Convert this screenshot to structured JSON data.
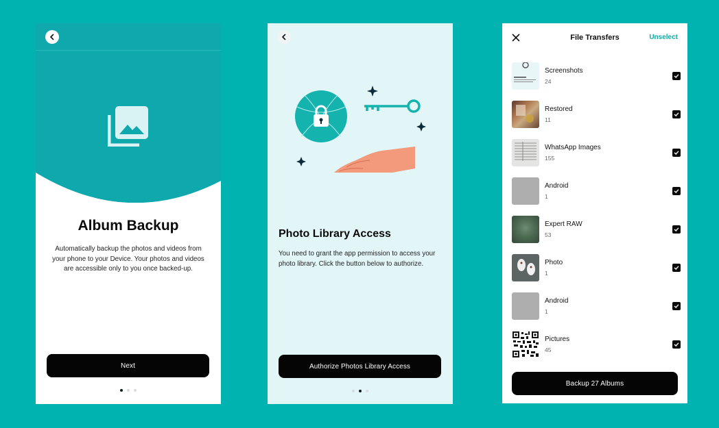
{
  "screens": [
    {
      "title": "Album Backup",
      "description": "Automatically backup the photos and videos from your phone to your Device. Your photos and videos are accessible only to you once backed-up.",
      "cta_label": "Next",
      "active_step": 1,
      "total_steps": 3
    },
    {
      "title": "Photo Library Access",
      "description": "You need to grant the app permission to access your photo library. Click the button below to authorize.",
      "cta_label": "Authorize Photos Library Access",
      "active_step": 2,
      "total_steps": 3
    },
    {
      "title": "File Transfers",
      "unselect_label": "Unselect",
      "albums": [
        {
          "name": "Screenshots",
          "count": "24",
          "selected": true
        },
        {
          "name": "Restored",
          "count": "11",
          "selected": true
        },
        {
          "name": "WhatsApp Images",
          "count": "155",
          "selected": true
        },
        {
          "name": "Android",
          "count": "1",
          "selected": true
        },
        {
          "name": "Expert RAW",
          "count": "53",
          "selected": true
        },
        {
          "name": "Photo",
          "count": "1",
          "selected": true
        },
        {
          "name": "Android",
          "count": "1",
          "selected": true
        },
        {
          "name": "Pictures",
          "count": "45",
          "selected": true
        }
      ],
      "cta_label": "Backup 27 Albums"
    }
  ],
  "icons": {
    "back": "chevron-left-icon",
    "close": "close-icon",
    "album": "photo-album-icon",
    "checkbox": "checkbox-checked-icon"
  },
  "colors": {
    "background": "#00b3b1",
    "accent": "#14a9a4",
    "header_teal": "#0ea8ad",
    "button": "#050505",
    "screen2_bg": "#e2f6f8"
  }
}
